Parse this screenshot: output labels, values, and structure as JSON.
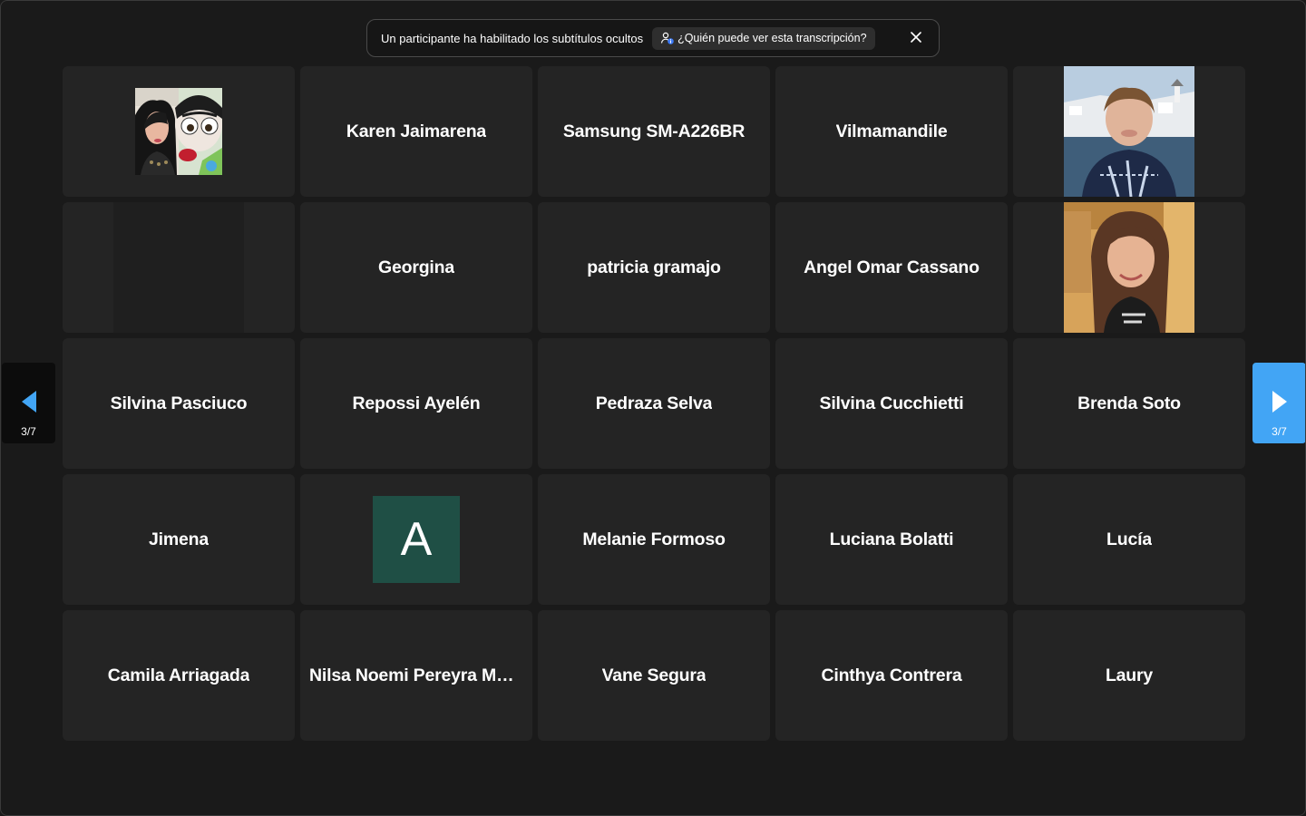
{
  "banner": {
    "message": "Un participante ha habilitado los subtítulos ocultos",
    "who_label": "¿Quién puede ver esta transcripción?",
    "icons": {
      "who": "person-info-icon",
      "close": "close-icon"
    }
  },
  "pager": {
    "left_label": "3/7",
    "right_label": "3/7",
    "accent_color": "#42a5f5"
  },
  "participants": [
    {
      "name": "",
      "kind": "avatar-image",
      "icon": "frida-avatar-image"
    },
    {
      "name": "Karen Jaimarena",
      "kind": "name"
    },
    {
      "name": "Samsung SM-A226BR",
      "kind": "name"
    },
    {
      "name": "Vilmamandile",
      "kind": "name"
    },
    {
      "name": "",
      "kind": "video",
      "icon": "participant-photo-woman-coast"
    },
    {
      "name": "",
      "kind": "video-off"
    },
    {
      "name": "Georgina",
      "kind": "name"
    },
    {
      "name": "patricia gramajo",
      "kind": "name"
    },
    {
      "name": "Angel Omar Cassano",
      "kind": "name"
    },
    {
      "name": "",
      "kind": "video",
      "icon": "participant-photo-woman-smiling"
    },
    {
      "name": "Silvina Pasciuco",
      "kind": "name"
    },
    {
      "name": "Repossi Ayelén",
      "kind": "name"
    },
    {
      "name": "Pedraza Selva",
      "kind": "name"
    },
    {
      "name": "Silvina Cucchietti",
      "kind": "name"
    },
    {
      "name": "Brenda Soto",
      "kind": "name"
    },
    {
      "name": "Jimena",
      "kind": "name"
    },
    {
      "name": "",
      "kind": "initial",
      "initial": "A",
      "color": "#1f4f45"
    },
    {
      "name": "Melanie Formoso",
      "kind": "name"
    },
    {
      "name": "Luciana Bolatti",
      "kind": "name"
    },
    {
      "name": "Lucía",
      "kind": "name"
    },
    {
      "name": "Camila Arriagada",
      "kind": "name"
    },
    {
      "name": "Nilsa Noemi Pereyra Müll...",
      "kind": "name"
    },
    {
      "name": "Vane Segura",
      "kind": "name"
    },
    {
      "name": "Cinthya Contrera",
      "kind": "name"
    },
    {
      "name": "Laury",
      "kind": "name"
    }
  ]
}
